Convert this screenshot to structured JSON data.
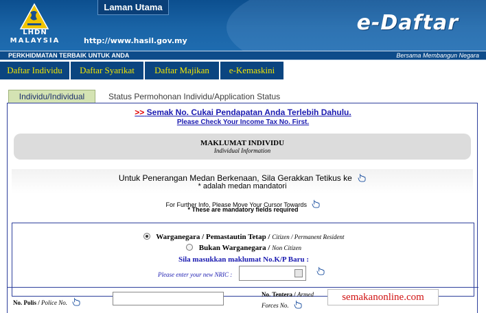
{
  "header": {
    "logo_text_1": "LHDN",
    "logo_text_2": "MALAYSIA",
    "home_tab_label": "Laman Utama",
    "site_url": "http://www.hasil.gov.my",
    "app_title": "e-Daftar",
    "slogan_left": "PERKHIDMATAN TERBAIK UNTUK ANDA",
    "slogan_right": "Bersama Membangun Negara"
  },
  "nav": {
    "items": [
      {
        "label": "Daftar Individu"
      },
      {
        "label": "Daftar Syarikat"
      },
      {
        "label": "Daftar Majikan"
      },
      {
        "label": "e-Kemaskini"
      }
    ]
  },
  "subtabs": {
    "active": "Individu/Individual",
    "other": "Status Permohonan Individu/Application Status"
  },
  "content": {
    "check_link_arrows": ">>",
    "check_link_ms": "Semak No. Cukai Pendapatan Anda Terlebih Dahulu.",
    "check_link_en": "Please Check Your Income Tax No. First.",
    "section_title": "MAKLUMAT INDIVIDU",
    "section_subtitle": "Individual Information",
    "info_ms_1": "Untuk Penerangan Medan Berkenaan, Sila Gerakkan Tetikus ke",
    "info_ms_2": "* adalah medan mandatori",
    "info_en_1": "For Further Info, Please Move Your Cursor Towards",
    "info_en_2": "* These are mandatory fields required"
  },
  "citizenship": {
    "option1_label": "Warganegara / Pemastautin Tetap /",
    "option1_en": "Citizen / Permanent Resident",
    "option1_checked": true,
    "option2_label": "Bukan Warganegara /",
    "option2_en": "Non Citizen",
    "option2_checked": false,
    "nric_prompt": "Sila masukkan maklumat No.K/P Baru :",
    "nric_prompt_en": "Please enter your new NRIC :",
    "nric_value": ""
  },
  "bottom": {
    "polis_label": "No. Polis /",
    "polis_label_en": "Police No.",
    "polis_value": "",
    "tentera_label": "No. Tentera /",
    "tentera_label_en_1": "Armed",
    "tentera_label_en_2": "Forces No.",
    "watermark": "semakanonline.com"
  },
  "icons": {
    "pointer": "hand-pointer-icon",
    "keyboard": "keyboard-icon",
    "logo": "lhdn-emblem-icon"
  },
  "colors": {
    "banner_blue": "#1a64a6",
    "nav_blue": "#0b4580",
    "nav_text": "#f2e600",
    "link_blue": "#1a1ab0",
    "link_red": "#e00000",
    "watermark_red": "#d01010"
  }
}
